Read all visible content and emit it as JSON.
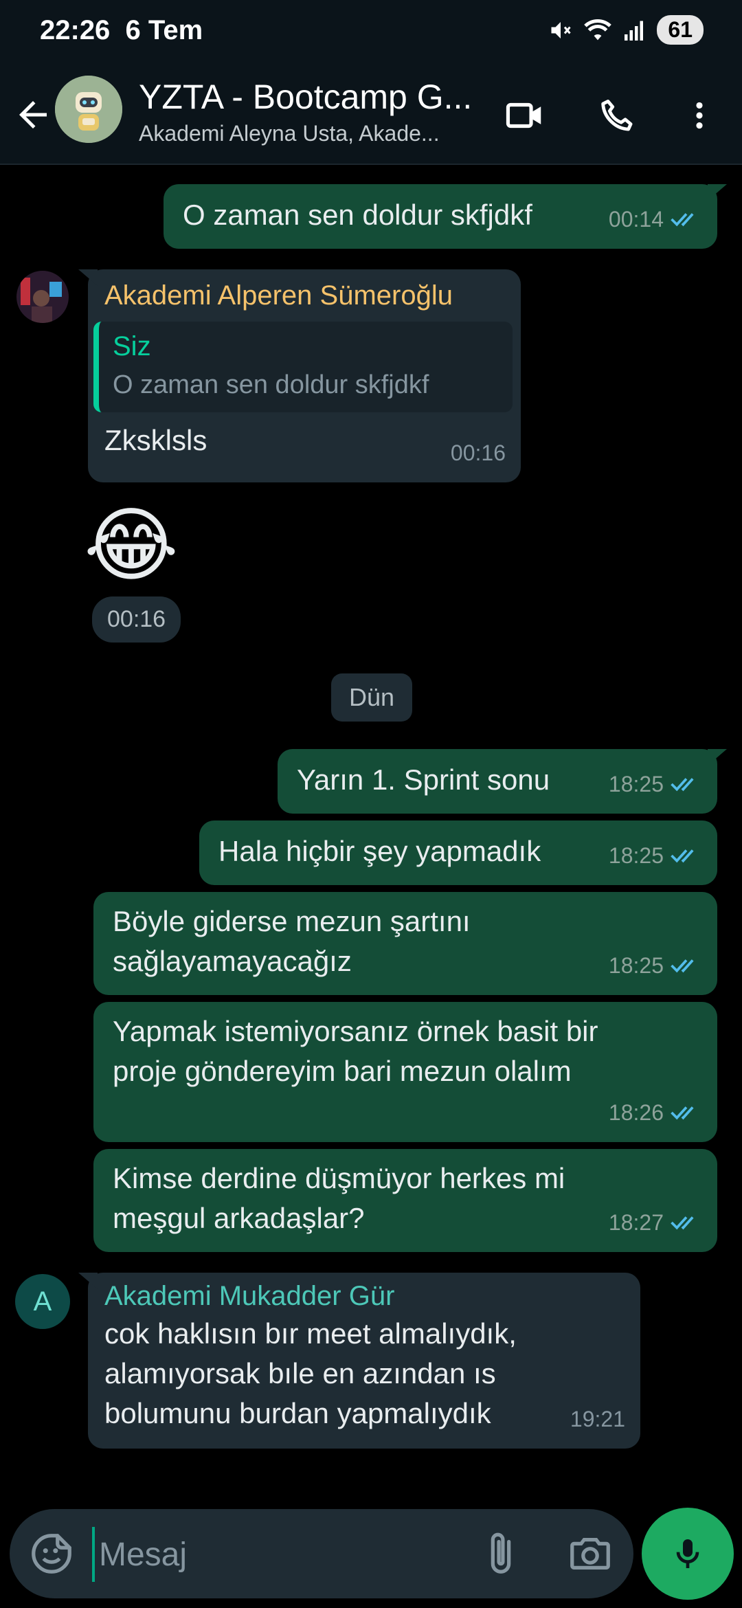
{
  "status_bar": {
    "time": "22:26",
    "date": "6 Tem",
    "battery": "61"
  },
  "header": {
    "title": "YZTA - Bootcamp G...",
    "subtitle": "Akademi Aleyna Usta, Akade..."
  },
  "messages": {
    "m1": {
      "text": "O zaman sen doldur skfjdkf",
      "time": "00:14"
    },
    "m2": {
      "sender": "Akademi Alperen Sümeroğlu",
      "quote_author": "Siz",
      "quote_text": "O zaman sen doldur skfjdkf",
      "text": "Zksklsls",
      "time": "00:16"
    },
    "m3": {
      "emoji": "😂",
      "time": "00:16"
    },
    "date_divider": "Dün",
    "m4": {
      "text": "Yarın 1. Sprint sonu",
      "time": "18:25"
    },
    "m5": {
      "text": "Hala hiçbir şey yapmadık",
      "time": "18:25"
    },
    "m6": {
      "line1": "Böyle giderse mezun şartını",
      "line2": "sağlayamayacağız",
      "time": "18:25"
    },
    "m7": {
      "line1": "Yapmak istemiyorsanız örnek basit bir",
      "line2": "proje göndereyim bari mezun olalım",
      "time": "18:26"
    },
    "m8": {
      "line1": "Kimse derdine düşmüyor herkes mi",
      "line2": "meşgul arkadaşlar?",
      "time": "18:27"
    },
    "m9": {
      "sender": "Akademi Mukadder Gür",
      "avatar_letter": "A",
      "line1": "cok haklısın bır meet almalıydık,",
      "line2": "alamıyorsak bıle en azından ıs",
      "line3": "bolumunu burdan yapmalıydık",
      "time": "19:21"
    }
  },
  "composer": {
    "placeholder": "Mesaj"
  },
  "colors": {
    "outgoing_bubble": "#144d37",
    "incoming_bubble": "#1f2c34",
    "read_tick": "#53bdeb",
    "sender_alperen": "#f5c26b",
    "sender_mukadder": "#4dc8b8",
    "mic_button": "#1daa61"
  },
  "icons": [
    "back-arrow-icon",
    "video-call-icon",
    "phone-icon",
    "more-vert-icon",
    "sticker-icon",
    "attach-icon",
    "camera-icon",
    "mic-icon",
    "double-check-icon"
  ]
}
